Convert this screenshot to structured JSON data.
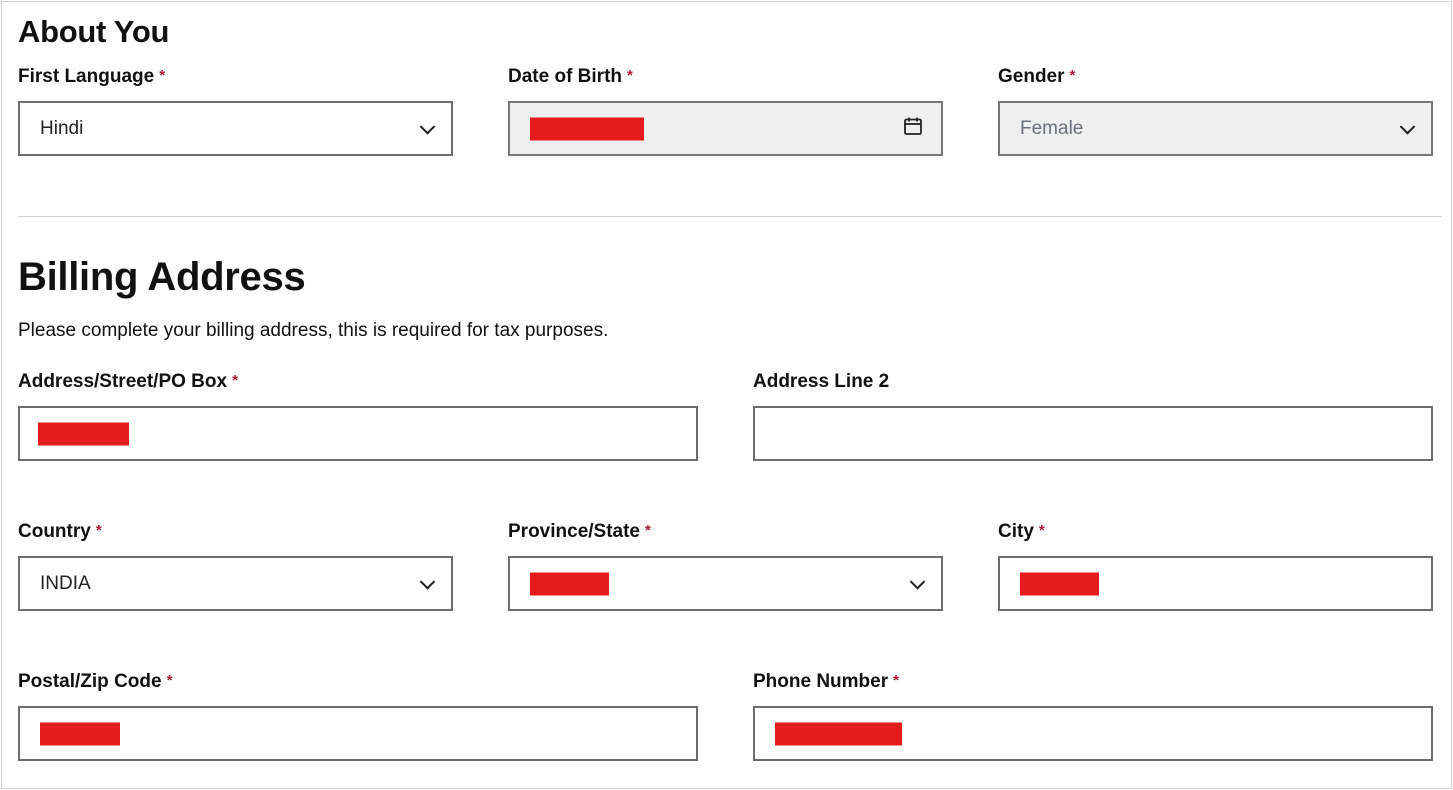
{
  "about_you": {
    "title": "About You",
    "first_language": {
      "label": "First Language",
      "value": "Hindi",
      "required": "*"
    },
    "date_of_birth": {
      "label": "Date of Birth",
      "required": "*",
      "value_redacted": true
    },
    "gender": {
      "label": "Gender",
      "value": "Female",
      "required": "*"
    }
  },
  "billing_address": {
    "title": "Billing Address",
    "description": "Please complete your billing address, this is required for tax purposes.",
    "address_street": {
      "label": "Address/Street/PO Box",
      "required": "*",
      "value_redacted": true
    },
    "address_line_2": {
      "label": "Address Line 2",
      "value": ""
    },
    "country": {
      "label": "Country",
      "value": "INDIA",
      "required": "*"
    },
    "province_state": {
      "label": "Province/State",
      "required": "*",
      "value_redacted": true
    },
    "city": {
      "label": "City",
      "required": "*",
      "value_redacted": true
    },
    "postal_code": {
      "label": "Postal/Zip Code",
      "required": "*",
      "value_redacted": true
    },
    "phone_number": {
      "label": "Phone Number",
      "required": "*",
      "value_redacted": true
    }
  },
  "icons": {
    "select": "chevron-down-icon",
    "date": "calendar-icon",
    "required": "asterisk"
  },
  "colors": {
    "required_asterisk": "#b0182f",
    "redaction": "#e41b1b",
    "disabled_bg": "#efefef",
    "border": "#6d6d6d"
  }
}
